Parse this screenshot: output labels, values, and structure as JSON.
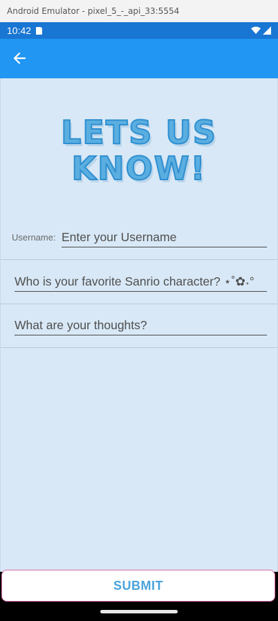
{
  "window": {
    "title": "Android Emulator - pixel_5_-_api_33:5554"
  },
  "status_bar": {
    "time": "10:42",
    "icons": [
      "sd-card-icon",
      "wifi-icon",
      "signal-icon"
    ]
  },
  "app_bar": {
    "back_icon": "arrow-left-icon",
    "color": "#2196f3"
  },
  "hero": {
    "line1": "LETS US",
    "line2": "KNOW!"
  },
  "form": {
    "username_label": "Username:",
    "username_placeholder": "Enter your Username",
    "character_placeholder": "Who is your favorite Sanrio character? ⋆˚✿˖°",
    "thoughts_placeholder": "What are your thoughts?"
  },
  "submit": {
    "label": "SUBMIT"
  },
  "colors": {
    "background": "#d8e8f6",
    "accent": "#4aa3db",
    "submit_border": "#e06aa8"
  }
}
